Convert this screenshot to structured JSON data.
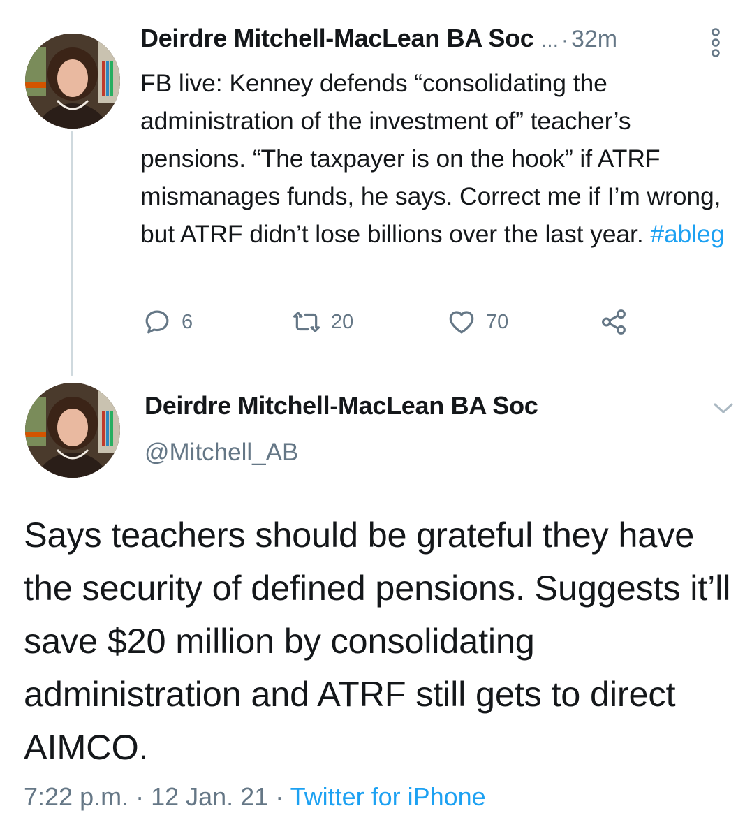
{
  "tweet1": {
    "author_name": "Deirdre Mitchell-MacLean BA Soc",
    "ellipsis": "...",
    "separator": "·",
    "time": "32m",
    "text": "FB live: Kenney defends “consolidating the administration of the investment of” teacher’s pensions. “The taxpayer is on the hook” if ATRF mismanages funds, he says. Correct me if I’m wrong, but ATRF didn’t lose billions over the last year. ",
    "hashtag": "#ableg",
    "actions": {
      "reply_count": "6",
      "retweet_count": "20",
      "like_count": "70"
    },
    "icons": [
      "reply-icon",
      "retweet-icon",
      "like-icon",
      "share-icon",
      "more-icon"
    ]
  },
  "tweet2": {
    "author_name": "Deirdre Mitchell-MacLean BA Soc",
    "handle": "@Mitchell_AB",
    "text": "Says teachers should be grateful they have the security of defined pensions. Suggests it’ll save $20 million by consolidating administration and ATRF still gets to direct AIMCO.",
    "time": "7:22 p.m.",
    "separator": " · ",
    "date": "12 Jan. 21",
    "source": "Twitter for iPhone",
    "icons": [
      "chevron-down-icon"
    ]
  },
  "colors": {
    "text": "#14171a",
    "secondary": "#657786",
    "link": "#1da1f2",
    "thread_line": "#cfd9de"
  }
}
